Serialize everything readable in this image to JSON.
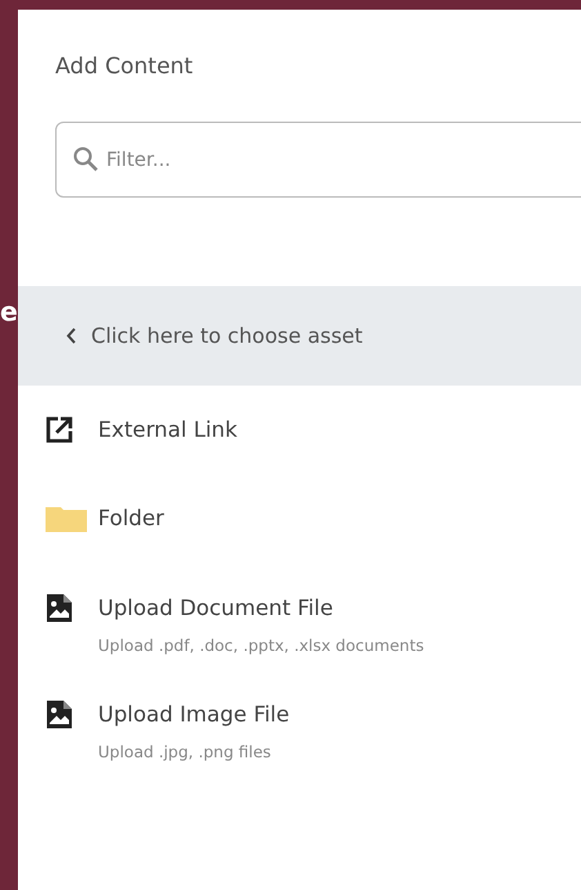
{
  "background_text": "e",
  "panel": {
    "title": "Add Content",
    "filter": {
      "placeholder": "Filter..."
    },
    "back_link": {
      "label": "Click here to choose asset"
    },
    "items": [
      {
        "kind": "link",
        "label": "External Link"
      },
      {
        "kind": "folder",
        "label": "Folder"
      },
      {
        "kind": "file",
        "label": "Upload Document File",
        "description": "Upload .pdf, .doc, .pptx, .xlsx documents"
      },
      {
        "kind": "file",
        "label": "Upload Image File",
        "description": "Upload .jpg, .png files"
      }
    ]
  }
}
